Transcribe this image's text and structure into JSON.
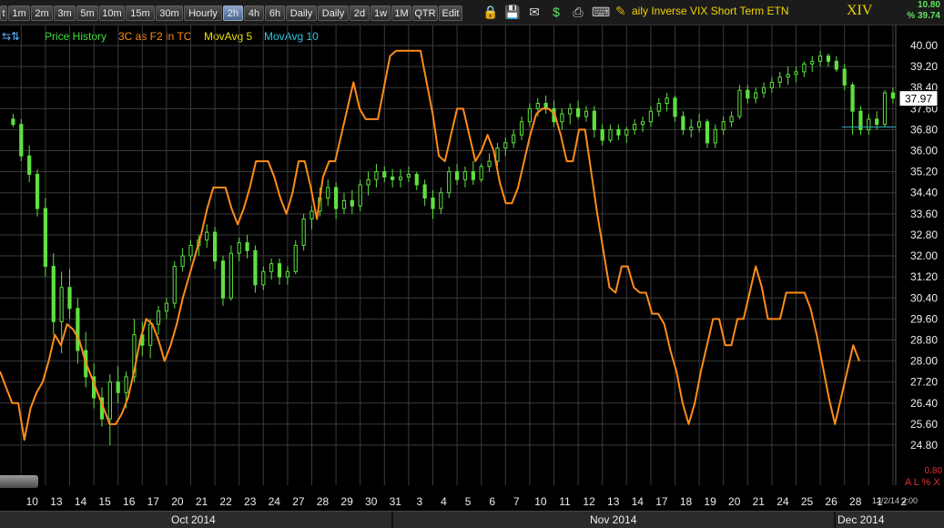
{
  "toolbar": {
    "buttons": [
      "t",
      "1m",
      "2m",
      "3m",
      "5m",
      "10m",
      "15m",
      "30m",
      "Hourly",
      "2h",
      "4h",
      "6h",
      "Daily",
      "Daily",
      "2d",
      "1w",
      "1M",
      "QTR",
      "Edit"
    ],
    "active": "2h",
    "icons": [
      "lock-icon",
      "save-icon",
      "envelope-icon",
      "dollar-icon",
      "print-icon",
      "keyboard-icon",
      "pencil-icon"
    ]
  },
  "header": {
    "instrument": "aily Inverse VIX Short Term ETN",
    "ticker": "XIV",
    "quote_line1": "10.80",
    "quote_line2": "% 39.74"
  },
  "legend": {
    "arrows": "⇆⇅",
    "items": [
      {
        "label": "Price History",
        "color": "#3ee03e"
      },
      {
        "label": "3C as F2 in TC",
        "color": "#ff8c1a"
      },
      {
        "label": "MovAvg 5",
        "color": "#e8e000"
      },
      {
        "label": "MovAvg 10",
        "color": "#30c8e0"
      }
    ]
  },
  "colors": {
    "candle": "#5fe040",
    "indicator": "#ff8c1a",
    "grid": "#3a3a3a",
    "current_line": "#30a8b8"
  },
  "footer": {
    "datestamp": "12/2/14 2:00",
    "bottom_value": "0.80",
    "alx": "A L % X",
    "months": [
      "Oct 2014",
      "Nov 2014",
      "Dec 2014"
    ]
  },
  "chart_data": {
    "type": "candlestick",
    "y_axis_ticks": [
      "40.00",
      "39.20",
      "38.40",
      "37.60",
      "36.80",
      "36.00",
      "35.20",
      "34.40",
      "33.60",
      "32.80",
      "32.00",
      "31.20",
      "30.40",
      "29.60",
      "28.80",
      "28.00",
      "27.20",
      "26.40",
      "25.60",
      "24.80"
    ],
    "ylim": [
      24.4,
      40.4
    ],
    "current_price": "37.97",
    "x_day_labels": [
      "10",
      "13",
      "14",
      "15",
      "16",
      "17",
      "20",
      "21",
      "22",
      "23",
      "24",
      "27",
      "28",
      "29",
      "30",
      "31",
      "3",
      "4",
      "5",
      "6",
      "7",
      "10",
      "11",
      "12",
      "13",
      "14",
      "17",
      "18",
      "19",
      "20",
      "21",
      "24",
      "25",
      "26",
      "28",
      "1",
      "2"
    ],
    "grid": true,
    "price_series": [
      {
        "day": "10",
        "candles": [
          [
            37.2,
            37.4,
            36.9,
            37.0
          ],
          [
            37.0,
            37.2,
            35.6,
            35.8
          ],
          [
            35.8,
            36.2,
            34.8,
            35.1
          ]
        ]
      },
      {
        "day": "13",
        "candles": [
          [
            35.1,
            35.3,
            33.5,
            33.8
          ],
          [
            33.8,
            34.2,
            31.2,
            31.6
          ],
          [
            31.6,
            32.1,
            29.0,
            29.5
          ]
        ]
      },
      {
        "day": "14",
        "candles": [
          [
            29.5,
            31.4,
            28.3,
            30.8
          ],
          [
            30.8,
            31.5,
            29.6,
            30.0
          ],
          [
            30.0,
            30.4,
            27.9,
            28.4
          ]
        ]
      },
      {
        "day": "15",
        "candles": [
          [
            28.4,
            29.1,
            27.0,
            27.4
          ],
          [
            27.4,
            27.9,
            26.2,
            26.6
          ],
          [
            26.6,
            27.0,
            25.5,
            25.8
          ]
        ]
      },
      {
        "day": "16",
        "candles": [
          [
            25.8,
            27.5,
            24.8,
            27.2
          ],
          [
            27.2,
            27.8,
            26.4,
            26.8
          ],
          [
            26.8,
            27.6,
            26.2,
            27.4
          ]
        ]
      },
      {
        "day": "17",
        "candles": [
          [
            27.4,
            29.6,
            27.2,
            29.0
          ],
          [
            29.0,
            29.5,
            28.2,
            28.6
          ],
          [
            28.6,
            29.6,
            28.1,
            29.4
          ]
        ]
      },
      {
        "day": "20",
        "candles": [
          [
            29.4,
            30.1,
            29.0,
            29.9
          ],
          [
            29.9,
            30.4,
            29.6,
            30.2
          ],
          [
            30.2,
            31.8,
            30.0,
            31.6
          ]
        ]
      },
      {
        "day": "21",
        "candles": [
          [
            31.6,
            32.3,
            31.4,
            32.0
          ],
          [
            32.0,
            32.6,
            31.8,
            32.4
          ],
          [
            32.4,
            32.8,
            32.0,
            32.6
          ]
        ]
      },
      {
        "day": "22",
        "candles": [
          [
            32.6,
            33.2,
            32.3,
            32.9
          ],
          [
            32.9,
            33.1,
            31.5,
            31.8
          ],
          [
            31.8,
            32.0,
            30.1,
            30.4
          ]
        ]
      },
      {
        "day": "23",
        "candles": [
          [
            30.4,
            32.4,
            30.3,
            32.1
          ],
          [
            32.1,
            32.7,
            31.8,
            32.5
          ],
          [
            32.5,
            32.8,
            31.9,
            32.2
          ]
        ]
      },
      {
        "day": "24",
        "candles": [
          [
            32.2,
            32.4,
            30.6,
            30.9
          ],
          [
            30.9,
            31.6,
            30.7,
            31.4
          ],
          [
            31.4,
            31.9,
            31.1,
            31.7
          ]
        ]
      },
      {
        "day": "27",
        "candles": [
          [
            31.7,
            31.9,
            30.9,
            31.2
          ],
          [
            31.2,
            31.6,
            30.9,
            31.4
          ],
          [
            31.4,
            32.6,
            31.3,
            32.4
          ]
        ]
      },
      {
        "day": "28",
        "candles": [
          [
            32.4,
            33.6,
            32.2,
            33.4
          ],
          [
            33.4,
            33.9,
            33.0,
            33.7
          ],
          [
            33.7,
            34.6,
            33.5,
            34.2
          ]
        ]
      },
      {
        "day": "29",
        "candles": [
          [
            34.2,
            34.9,
            33.9,
            34.6
          ],
          [
            34.6,
            34.8,
            33.4,
            33.8
          ],
          [
            33.8,
            34.4,
            33.6,
            34.1
          ]
        ]
      },
      {
        "day": "30",
        "candles": [
          [
            34.1,
            34.5,
            33.6,
            33.9
          ],
          [
            33.9,
            34.9,
            33.7,
            34.7
          ],
          [
            34.7,
            35.2,
            34.3,
            34.9
          ]
        ]
      },
      {
        "day": "31",
        "candles": [
          [
            34.9,
            35.5,
            34.6,
            35.2
          ],
          [
            35.2,
            35.4,
            34.8,
            35.0
          ],
          [
            35.0,
            35.3,
            34.6,
            34.9
          ]
        ]
      },
      {
        "day": "3",
        "candles": [
          [
            34.9,
            35.3,
            34.6,
            35.0
          ],
          [
            35.0,
            35.4,
            34.8,
            35.1
          ],
          [
            35.1,
            35.2,
            34.5,
            34.7
          ]
        ]
      },
      {
        "day": "4",
        "candles": [
          [
            34.7,
            34.9,
            33.9,
            34.2
          ],
          [
            34.2,
            34.5,
            33.4,
            33.8
          ],
          [
            33.8,
            34.6,
            33.6,
            34.4
          ]
        ]
      },
      {
        "day": "5",
        "candles": [
          [
            34.4,
            35.4,
            34.2,
            35.2
          ],
          [
            35.2,
            35.5,
            34.7,
            34.9
          ],
          [
            34.9,
            35.4,
            34.6,
            35.2
          ]
        ]
      },
      {
        "day": "6",
        "candles": [
          [
            35.2,
            35.6,
            34.7,
            34.9
          ],
          [
            34.9,
            35.5,
            34.8,
            35.4
          ],
          [
            35.4,
            35.9,
            35.2,
            35.6
          ]
        ]
      },
      {
        "day": "7",
        "candles": [
          [
            35.6,
            36.3,
            35.4,
            36.1
          ],
          [
            36.1,
            36.5,
            35.8,
            36.3
          ],
          [
            36.3,
            36.8,
            36.1,
            36.6
          ]
        ]
      },
      {
        "day": "10",
        "candles": [
          [
            36.6,
            37.3,
            36.4,
            37.1
          ],
          [
            37.1,
            37.8,
            36.9,
            37.6
          ],
          [
            37.6,
            38.0,
            37.3,
            37.8
          ]
        ]
      },
      {
        "day": "11",
        "candles": [
          [
            37.8,
            38.1,
            37.4,
            37.6
          ],
          [
            37.6,
            37.9,
            36.9,
            37.1
          ],
          [
            37.1,
            37.6,
            36.8,
            37.4
          ]
        ]
      },
      {
        "day": "12",
        "candles": [
          [
            37.4,
            37.8,
            37.0,
            37.6
          ],
          [
            37.6,
            37.9,
            37.2,
            37.3
          ],
          [
            37.3,
            37.7,
            37.1,
            37.5
          ]
        ]
      },
      {
        "day": "13",
        "candles": [
          [
            37.5,
            37.7,
            36.5,
            36.8
          ],
          [
            36.8,
            37.0,
            36.2,
            36.4
          ],
          [
            36.4,
            37.0,
            36.3,
            36.8
          ]
        ]
      },
      {
        "day": "14",
        "candles": [
          [
            36.8,
            37.0,
            36.4,
            36.6
          ],
          [
            36.6,
            36.9,
            36.3,
            36.8
          ],
          [
            36.8,
            37.2,
            36.6,
            37.0
          ]
        ]
      },
      {
        "day": "17",
        "candles": [
          [
            37.0,
            37.3,
            36.7,
            37.1
          ],
          [
            37.1,
            37.7,
            36.9,
            37.5
          ],
          [
            37.5,
            38.0,
            37.3,
            37.8
          ]
        ]
      },
      {
        "day": "18",
        "candles": [
          [
            37.8,
            38.2,
            37.5,
            38.0
          ],
          [
            38.0,
            38.1,
            37.1,
            37.3
          ],
          [
            37.3,
            37.5,
            36.6,
            36.8
          ]
        ]
      },
      {
        "day": "19",
        "candles": [
          [
            36.8,
            37.2,
            36.5,
            36.9
          ],
          [
            36.9,
            37.4,
            36.7,
            37.1
          ],
          [
            37.1,
            37.2,
            36.1,
            36.3
          ]
        ]
      },
      {
        "day": "20",
        "candles": [
          [
            36.3,
            37.0,
            36.1,
            36.8
          ],
          [
            36.8,
            37.3,
            36.6,
            37.1
          ],
          [
            37.1,
            37.5,
            36.9,
            37.3
          ]
        ]
      },
      {
        "day": "21",
        "candles": [
          [
            37.3,
            38.5,
            37.2,
            38.3
          ],
          [
            38.3,
            38.5,
            37.8,
            38.0
          ],
          [
            38.0,
            38.4,
            37.8,
            38.2
          ]
        ]
      },
      {
        "day": "24",
        "candles": [
          [
            38.2,
            38.6,
            38.0,
            38.4
          ],
          [
            38.4,
            38.8,
            38.2,
            38.6
          ],
          [
            38.6,
            39.0,
            38.4,
            38.8
          ]
        ]
      },
      {
        "day": "25",
        "candles": [
          [
            38.8,
            39.2,
            38.5,
            38.9
          ],
          [
            38.9,
            39.2,
            38.6,
            39.0
          ],
          [
            39.0,
            39.4,
            38.8,
            39.3
          ]
        ]
      },
      {
        "day": "26",
        "candles": [
          [
            39.3,
            39.6,
            39.0,
            39.4
          ],
          [
            39.4,
            39.8,
            39.2,
            39.6
          ],
          [
            39.6,
            39.7,
            39.2,
            39.4
          ]
        ]
      },
      {
        "day": "28",
        "candles": [
          [
            39.4,
            39.6,
            39.0,
            39.1
          ],
          [
            39.1,
            39.3,
            38.3,
            38.5
          ],
          [
            38.5,
            38.6,
            36.6,
            37.5
          ]
        ]
      },
      {
        "day": "1",
        "candles": [
          [
            37.5,
            37.7,
            36.6,
            36.8
          ],
          [
            36.8,
            37.4,
            36.6,
            37.2
          ],
          [
            37.2,
            37.5,
            36.8,
            37.0
          ]
        ]
      },
      {
        "day": "2",
        "candles": [
          [
            37.0,
            38.3,
            36.9,
            38.2
          ],
          [
            38.2,
            38.4,
            37.8,
            38.0
          ],
          [
            38.0,
            38.2,
            37.8,
            37.97
          ]
        ]
      }
    ],
    "indicator_3c_scaled": [
      27.6,
      27.0,
      26.4,
      26.4,
      25.0,
      26.2,
      26.8,
      27.2,
      28.0,
      29.0,
      28.6,
      29.4,
      29.2,
      28.8,
      28.0,
      27.4,
      26.8,
      26.2,
      25.6,
      25.6,
      26.0,
      26.6,
      27.6,
      28.8,
      29.6,
      29.4,
      28.8,
      28.0,
      28.6,
      29.4,
      30.4,
      31.2,
      32.0,
      32.8,
      33.8,
      34.6,
      34.6,
      34.6,
      33.8,
      33.2,
      33.8,
      34.6,
      35.6,
      35.6,
      35.6,
      35.0,
      34.2,
      33.6,
      34.4,
      35.6,
      35.6,
      34.6,
      33.4,
      35.0,
      35.6,
      35.6,
      36.6,
      37.6,
      38.6,
      37.6,
      37.2,
      37.2,
      37.2,
      38.4,
      39.6,
      39.8,
      39.8,
      39.8,
      39.8,
      39.8,
      38.6,
      37.4,
      35.8,
      35.6,
      36.6,
      37.6,
      37.6,
      36.6,
      35.6,
      36.0,
      36.6,
      36.0,
      34.8,
      34.0,
      34.0,
      34.6,
      35.6,
      36.6,
      37.4,
      37.6,
      37.6,
      37.4,
      36.6,
      35.6,
      35.6,
      36.8,
      36.8,
      35.2,
      33.6,
      32.2,
      30.8,
      30.6,
      31.6,
      31.6,
      30.8,
      30.6,
      30.6,
      29.8,
      29.8,
      29.4,
      28.4,
      27.6,
      26.4,
      25.6,
      26.4,
      27.6,
      28.6,
      29.6,
      29.6,
      28.6,
      28.6,
      29.6,
      29.6,
      30.6,
      31.6,
      30.8,
      29.6,
      29.6,
      29.6,
      30.6,
      30.6,
      30.6,
      30.6,
      30.0,
      29.0,
      27.8,
      26.6,
      25.6,
      26.6,
      27.6,
      28.6,
      28.0
    ]
  }
}
